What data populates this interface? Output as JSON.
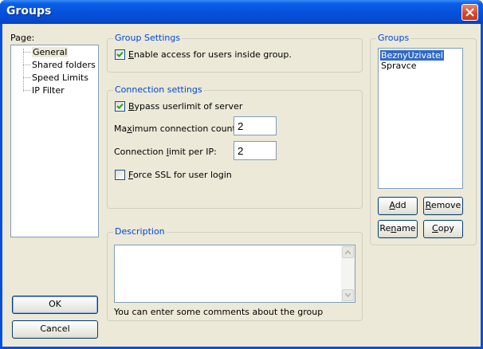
{
  "window": {
    "title": "Groups"
  },
  "page_panel": {
    "label": "Page:",
    "items": [
      "General",
      "Shared folders",
      "Speed Limits",
      "IP Filter"
    ],
    "selected": "General"
  },
  "group_settings": {
    "title": "Group Settings",
    "enable_access": {
      "label": "Enable access for users inside group.",
      "checked": true
    }
  },
  "connection_settings": {
    "title": "Connection settings",
    "bypass_userlimit": {
      "label": "Bypass userlimit of server",
      "checked": true
    },
    "max_connection": {
      "label": "Maximum connection count:",
      "value": "2"
    },
    "limit_per_ip": {
      "label": "Connection limit per IP:",
      "value": "2"
    },
    "force_ssl": {
      "label": "Force SSL for user login",
      "checked": false
    }
  },
  "description": {
    "title": "Description",
    "value": "",
    "hint": "You can enter some comments about the group"
  },
  "groups": {
    "title": "Groups",
    "items": [
      "BeznyUzivatel",
      "Spravce"
    ],
    "selected": "BeznyUzivatel",
    "add_label": "Add",
    "remove_label": "Remove",
    "rename_label": "Rename",
    "copy_label": "Copy"
  },
  "buttons": {
    "ok_label": "OK",
    "cancel_label": "Cancel"
  },
  "colors": {
    "accent": "#0046d5",
    "selection": "#316ac5",
    "titlebar": "#0552dd"
  }
}
